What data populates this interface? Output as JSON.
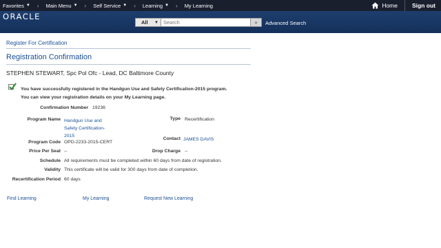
{
  "nav": {
    "favorites": "Favorites",
    "main_menu": "Main Menu",
    "self_service": "Self Service",
    "learning": "Learning",
    "my_learning": "My Learning",
    "home": "Home",
    "signout": "Sign out"
  },
  "header": {
    "logo": "ORACLE",
    "search_scope": "All",
    "search_placeholder": "Search",
    "advanced_search": "Advanced Search"
  },
  "page": {
    "crumb": "Register For Certification",
    "title": "Registration Confirmation",
    "person": "STEPHEN STEWART, Spc Pol Ofc - Lead, DC Baltimore County",
    "confirm_line1": "You have successfully registered in the Handgun Use and Safety Certification-2015 program.",
    "confirm_line2": "You can view your registration details on your My Learning page."
  },
  "details": {
    "confirmation_number_label": "Confirmation Number",
    "confirmation_number": "19236",
    "program_name_label": "Program Name",
    "program_name_1": "Handgun Use and",
    "program_name_2": "Safety Certification-",
    "program_name_3": "2015",
    "type_label": "Type",
    "type": "Recertification",
    "program_code_label": "Program Code",
    "program_code": "OPD-2233-2015-CERT",
    "contact_label": "Contact",
    "contact": "JAMES DAVIS",
    "price_label": "Price Per Seat",
    "price": "--",
    "drop_charge_label": "Drop Charge",
    "drop_charge": "--",
    "schedule_label": "Schedule",
    "schedule": "All requirements must be completed within 60 days from date of registration.",
    "validity_label": "Validity",
    "validity": "This certificate will be valid for 300 days from date of completion.",
    "recert_label": "Recertification Period",
    "recert": "60 days"
  },
  "footer_links": {
    "find_learning": "Find Learning",
    "my_learning": "My Learning",
    "request_new": "Request New Learning"
  },
  "colors": {
    "topbar": "#1a1f2e",
    "header": "#1e3e6e",
    "link": "#1a4f95",
    "check": "#2e8b2e"
  }
}
